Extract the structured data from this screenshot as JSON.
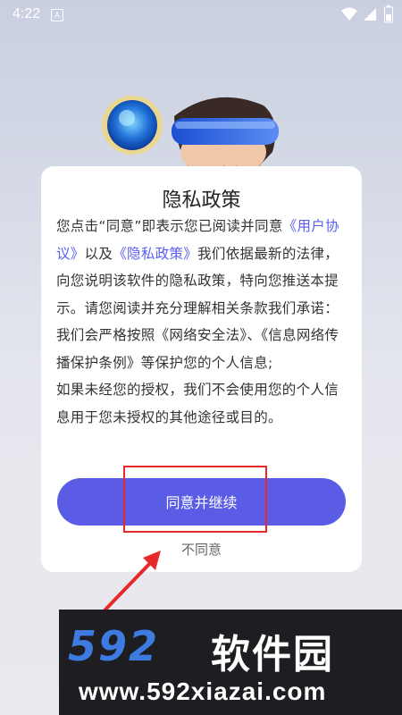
{
  "status_bar": {
    "time": "4:22",
    "notification_badge": "A",
    "icons": [
      "wifi-icon",
      "signal-icon",
      "battery-icon"
    ]
  },
  "dialog": {
    "title": "隐私政策",
    "body": {
      "intro_pre": "您点击“同意”即表示您已阅读并同意",
      "link_user_agreement": "《用户协议》",
      "and_text": "以及",
      "link_privacy_policy": "《隐私政策》",
      "intro_post": "我们依据最新的法律，向您说明该软件的隐私政策，特向您推送本提示。请您阅读并充分理解相关条款我们承诺：",
      "promise_1": "我们会严格按照《网络安全法》、《信息网络传播保护条例》等保护您的个人信息;",
      "promise_2": "如果未经您的授权，我们不会使用您的个人信息用于您未授权的其他途径或目的。"
    },
    "agree_button": "同意并继续",
    "disagree_button": "不同意"
  },
  "watermark": {
    "logo_digits": "592",
    "logo_text": "软件园",
    "url": "www.592xiazai.com"
  },
  "colors": {
    "accent": "#5a5ce6",
    "link": "#5a5ff0",
    "highlight": "#e62a2a"
  }
}
